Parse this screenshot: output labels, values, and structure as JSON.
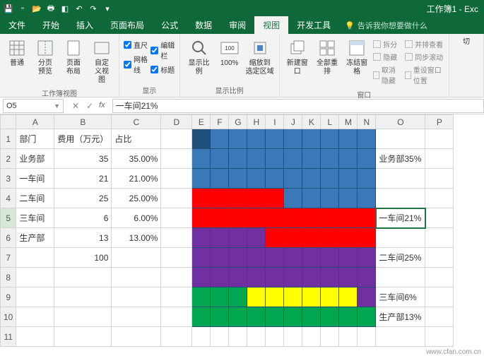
{
  "title": "工作簿1 - Exc",
  "qat": [
    "save",
    "undo",
    "redo",
    "new",
    "open",
    "print",
    "prev",
    "next",
    "more"
  ],
  "tabs": {
    "items": [
      "文件",
      "开始",
      "插入",
      "页面布局",
      "公式",
      "数据",
      "审阅",
      "视图",
      "开发工具"
    ],
    "active": 7,
    "tell_icon": "bulb",
    "tell": "告诉我你想要做什么"
  },
  "ribbon": {
    "g1": {
      "label": "工作簿视图",
      "btns": [
        "普通",
        "分页\n预览",
        "页面布局",
        "自定义视图"
      ]
    },
    "g2": {
      "label": "显示",
      "checks": [
        [
          "直尺",
          true
        ],
        [
          "编辑栏",
          true
        ],
        [
          "网格线",
          true
        ],
        [
          "标题",
          true
        ]
      ]
    },
    "g3": {
      "label": "显示比例",
      "btns": [
        "显示比例",
        "100%",
        "缩放到\n选定区域"
      ]
    },
    "g4": {
      "label": "窗口",
      "btns": [
        "新建窗口",
        "全部重排",
        "冻结窗格"
      ],
      "side": [
        "拆分",
        "隐藏",
        "取消隐藏"
      ],
      "side2": [
        "并排查看",
        "同步滚动",
        "重设窗口位置"
      ]
    },
    "g5": {
      "label": "",
      "btn": "切"
    }
  },
  "namebox": "O5",
  "formula": "一车间21%",
  "columns": [
    "",
    "A",
    "B",
    "C",
    "D",
    "E",
    "F",
    "G",
    "H",
    "I",
    "J",
    "K",
    "L",
    "M",
    "N",
    "O",
    "P"
  ],
  "rownums": [
    "1",
    "2",
    "3",
    "4",
    "5",
    "6",
    "7",
    "8",
    "9",
    "10",
    "11"
  ],
  "data": {
    "A1": "部门",
    "B1": "费用（万元）",
    "C1": "占比",
    "A2": "业务部",
    "B2": "35",
    "C2": "35.00%",
    "A3": "一车间",
    "B3": "21",
    "C3": "21.00%",
    "A4": "二车间",
    "B4": "25",
    "C4": "25.00%",
    "A5": "三车间",
    "B5": "6",
    "C5": "6.00%",
    "A6": "生产部",
    "B6": "13",
    "C6": "13.00%",
    "B7": "100",
    "O2": "业务部35%",
    "O5": "一车间21%",
    "O7": "二车间25%",
    "O9": "三车间6%",
    "O10": "生产部13%"
  },
  "chart_data": {
    "type": "waffle",
    "grid": "10x10",
    "series": [
      {
        "name": "业务部",
        "value": 35,
        "color": "#3b78b8"
      },
      {
        "name": "一车间",
        "value": 21,
        "color": "#ff0000"
      },
      {
        "name": "二车间",
        "value": 25,
        "color": "#7030a0"
      },
      {
        "name": "三车间",
        "value": 6,
        "color": "#ffff00"
      },
      {
        "name": "生产部",
        "value": 13,
        "color": "#00a650"
      }
    ]
  },
  "footer": "www.cfan.com.cn"
}
